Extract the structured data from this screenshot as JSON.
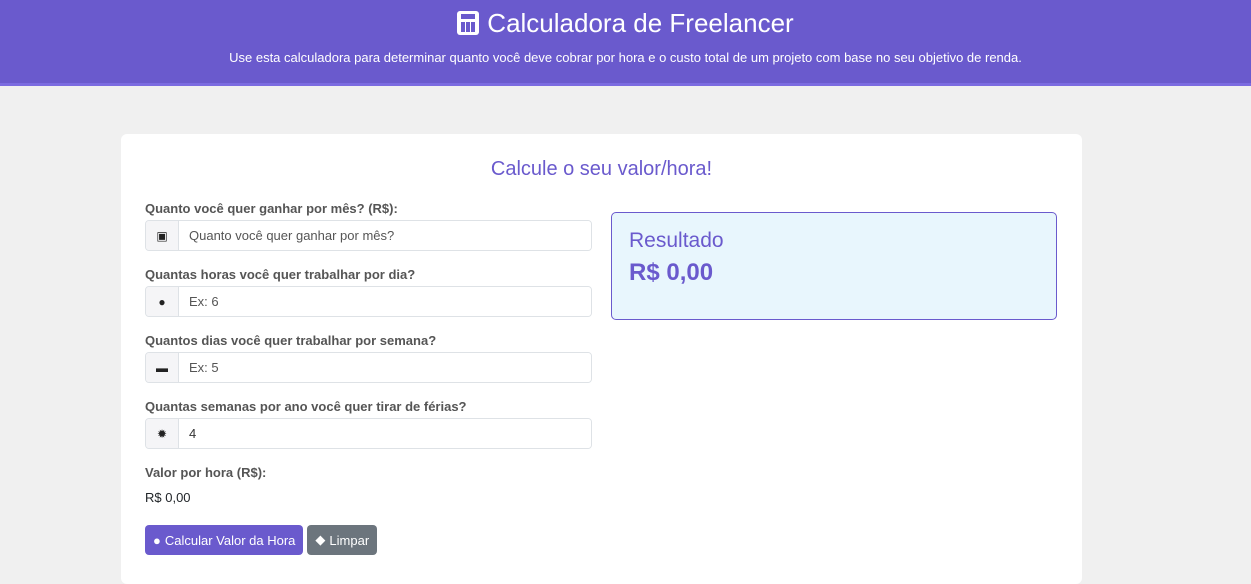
{
  "header": {
    "title": "Calculadora de Freelancer",
    "subtitle": "Use esta calculadora para determinar quanto você deve cobrar por hora e o custo total de um projeto com base no seu objetivo de renda."
  },
  "card": {
    "title": "Calcule o seu valor/hora!"
  },
  "fields": [
    {
      "label": "Quanto você quer ganhar por mês? (R$):",
      "placeholder": "Quanto você quer ganhar por mês?",
      "value": "",
      "icon": "money-bill-icon"
    },
    {
      "label": "Quantas horas você quer trabalhar por dia?",
      "placeholder": "Ex: 6",
      "value": "",
      "icon": "clock-icon"
    },
    {
      "label": "Quantos dias você quer trabalhar por semana?",
      "placeholder": "Ex: 5",
      "value": "",
      "icon": "calendar-icon"
    },
    {
      "label": "Quantas semanas por ano você quer tirar de férias?",
      "placeholder": "",
      "value": "4",
      "icon": "sun-icon"
    }
  ],
  "hourly": {
    "label": "Valor por hora (R$):",
    "value": "R$ 0,00"
  },
  "buttons": {
    "calculate": "Calcular Valor da Hora",
    "clear": "Limpar"
  },
  "result": {
    "title": "Resultado",
    "value": "R$ 0,00"
  },
  "colors": {
    "accent": "#6a5acd",
    "result_bg": "#e8f6fd",
    "clear": "#6c757d"
  }
}
